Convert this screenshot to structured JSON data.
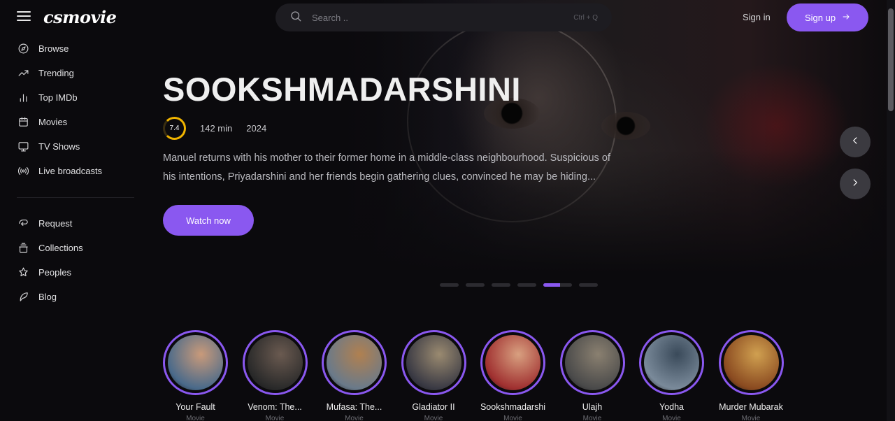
{
  "brand": {
    "logo": "csmovie"
  },
  "search": {
    "placeholder": "Search ..",
    "shortcut": "Ctrl + Q"
  },
  "auth": {
    "signin_label": "Sign in",
    "signup_label": "Sign up"
  },
  "sidebar": {
    "primary": [
      {
        "label": "Browse",
        "icon": "compass-icon"
      },
      {
        "label": "Trending",
        "icon": "trending-icon"
      },
      {
        "label": "Top IMDb",
        "icon": "bar-chart-icon"
      },
      {
        "label": "Movies",
        "icon": "calendar-film-icon"
      },
      {
        "label": "TV Shows",
        "icon": "tv-icon"
      },
      {
        "label": "Live broadcasts",
        "icon": "broadcast-icon"
      }
    ],
    "secondary": [
      {
        "label": "Request",
        "icon": "request-icon"
      },
      {
        "label": "Collections",
        "icon": "collections-icon"
      },
      {
        "label": "Peoples",
        "icon": "people-icon"
      },
      {
        "label": "Blog",
        "icon": "feather-icon"
      }
    ]
  },
  "hero": {
    "title": "SOOKSHMADARSHINI",
    "rating": "7.4",
    "runtime": "142 min",
    "year": "2024",
    "description": "Manuel returns with his mother to their former home in a middle-class neighbourhood. Suspicious of his intentions, Priyadarshini and her friends begin gathering clues, convinced he may be hiding...",
    "cta_label": "Watch now",
    "slide_count": 6,
    "active_slide": 5
  },
  "colors": {
    "accent": "#8a58f0",
    "rating": "#f0b400",
    "background": "#0b0a0d"
  },
  "featured": [
    {
      "title": "Your Fault",
      "type": "Movie",
      "tint": [
        "#4a6a8a",
        "#c99a7a"
      ]
    },
    {
      "title": "Venom: The...",
      "type": "Movie",
      "tint": [
        "#2a2a2a",
        "#6a5a50"
      ]
    },
    {
      "title": "Mufasa: The...",
      "type": "Movie",
      "tint": [
        "#6a7a8a",
        "#b08050"
      ]
    },
    {
      "title": "Gladiator II",
      "type": "Movie",
      "tint": [
        "#3a3a44",
        "#9a8a70"
      ]
    },
    {
      "title": "Sookshmadarshi",
      "type": "Movie",
      "tint": [
        "#a03030",
        "#d8a080"
      ]
    },
    {
      "title": "Ulajh",
      "type": "Movie",
      "tint": [
        "#4a4a4a",
        "#8a8070"
      ]
    },
    {
      "title": "Yodha",
      "type": "Movie",
      "tint": [
        "#7a8a9a",
        "#3a4a5a"
      ]
    },
    {
      "title": "Murder Mubarak",
      "type": "Movie",
      "tint": [
        "#8a4a20",
        "#d0a050"
      ]
    }
  ]
}
